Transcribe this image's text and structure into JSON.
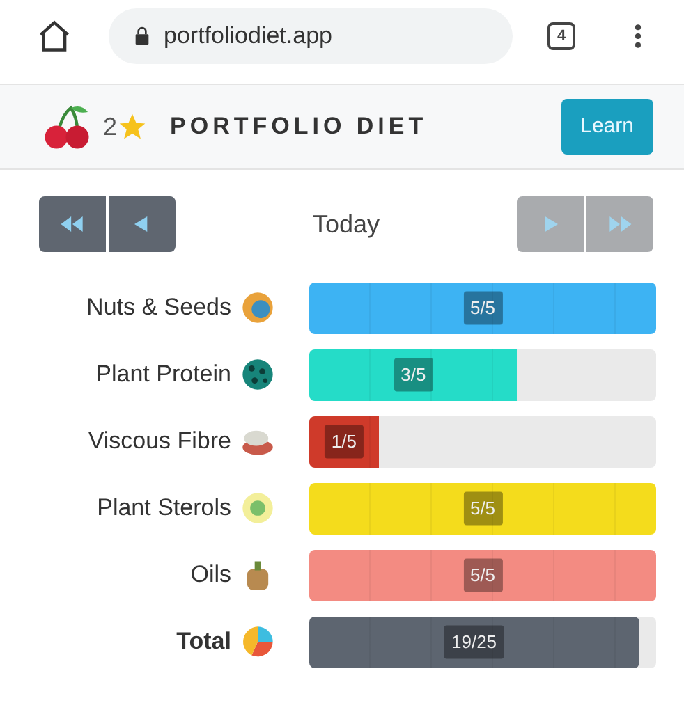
{
  "browser": {
    "url": "portfoliodiet.app",
    "tab_count": "4"
  },
  "header": {
    "stars_count": "2",
    "title": "PORTFOLIO DIET",
    "learn_button": "Learn"
  },
  "day_nav": {
    "label": "Today",
    "buttons": [
      {
        "kind": "first",
        "disabled": false
      },
      {
        "kind": "prev",
        "disabled": false
      },
      {
        "kind": "next",
        "disabled": true
      },
      {
        "kind": "last",
        "disabled": true
      }
    ]
  },
  "rows": [
    {
      "kind": "category",
      "label": "Nuts & Seeds",
      "level": 1,
      "reading": "5/5",
      "color": "#3db3f3"
    },
    {
      "kind": "category",
      "label": "Plant Protein",
      "level": 0.6,
      "reading": "3/5",
      "color": "#25dcc8"
    },
    {
      "kind": "category",
      "label": "Viscous Fibre",
      "level": 0.2,
      "reading": "1/5",
      "color": "#cf3a2a"
    },
    {
      "kind": "category",
      "label": "Plant Sterols",
      "level": 1,
      "reading": "5/5",
      "color": "#f4dc1c"
    },
    {
      "kind": "category",
      "label": "Oils",
      "level": 1,
      "reading": "5/5",
      "color": "#f38b82"
    },
    {
      "kind": "total",
      "label": "Total",
      "level": 0.95,
      "reading": "19/25",
      "color": "#5d6570"
    }
  ]
}
